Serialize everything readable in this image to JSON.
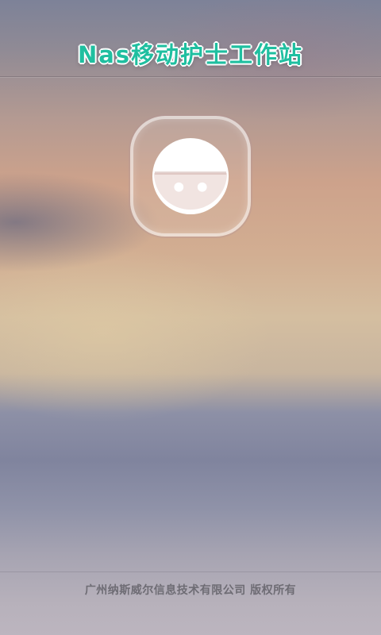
{
  "header": {
    "title": "Nas移动护士工作站"
  },
  "logo": {
    "icon": "smiley-face-icon"
  },
  "footer": {
    "copyright": "广州纳斯威尔信息技术有限公司  版权所有"
  },
  "colors": {
    "title_accent": "#1fbfa0",
    "title_outline": "#ffffff",
    "footer_text": "#6e6c74"
  }
}
